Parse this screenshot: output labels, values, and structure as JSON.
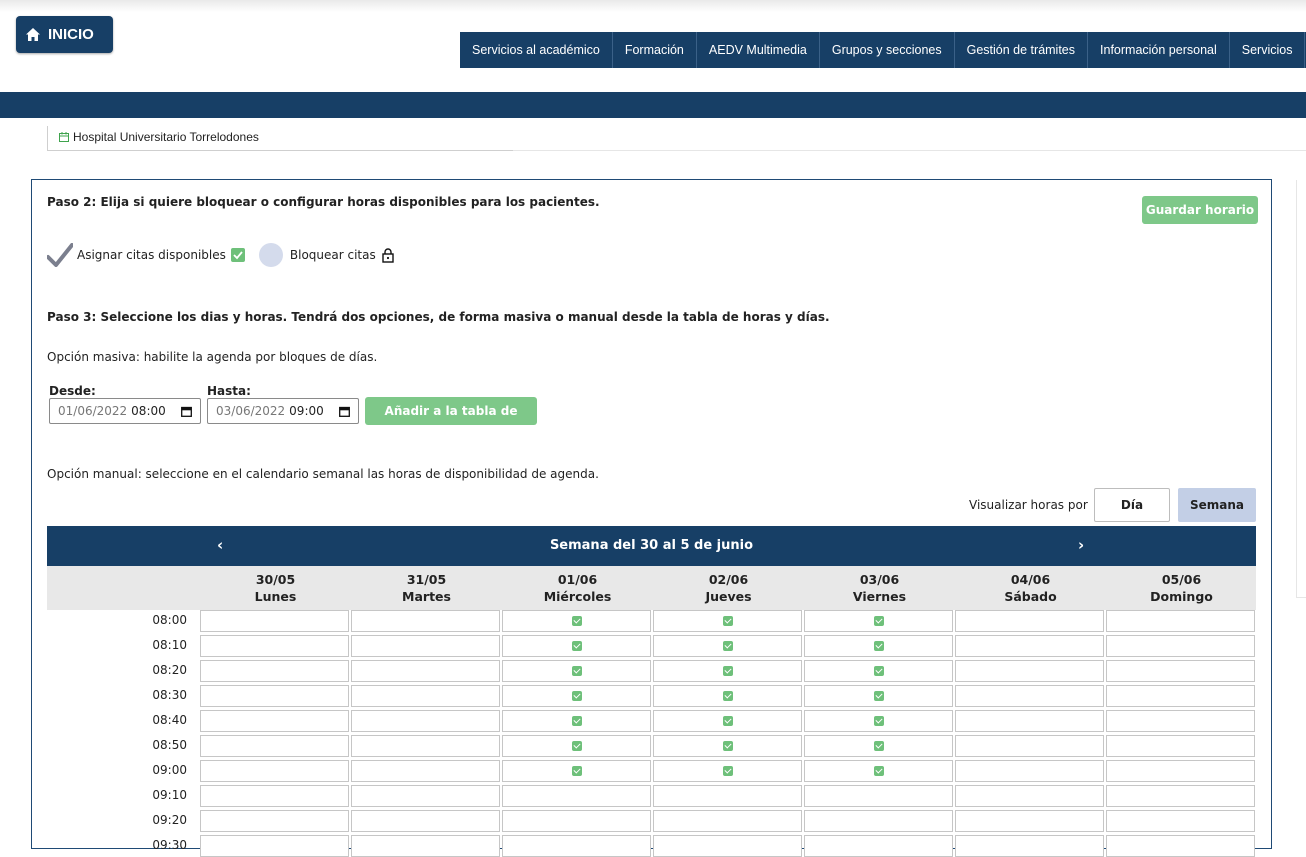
{
  "header": {
    "home_label": "INICIO",
    "nav_items": [
      "Servicios al académico",
      "Formación",
      "AEDV Multimedia",
      "Grupos y secciones",
      "Gestión de trámites",
      "Información personal",
      "Servicios"
    ]
  },
  "location": {
    "hospital": "Hospital Universitario Torrelodones"
  },
  "step2": {
    "title": "Paso 2: Elija si quiere bloquear o configurar horas disponibles para los pacientes.",
    "save_button": "Guardar horario",
    "option_assign": "Asignar citas disponibles",
    "option_block": "Bloquear citas",
    "selected": "Asignar citas disponibles"
  },
  "step3": {
    "title": "Paso 3: Seleccione los dias y horas. Tendrá dos opciones, de forma masiva o manual desde la tabla de horas y días.",
    "bulk_text": "Opción masiva: habilite la agenda por bloques de días.",
    "from_label": "Desde:",
    "from_value": {
      "date": "01/06/2022",
      "time": "08:00"
    },
    "to_label": "Hasta:",
    "to_value": {
      "date": "03/06/2022",
      "time": "09:00"
    },
    "add_button": "Añadir a la tabla de horas",
    "manual_text": "Opción manual: seleccione en el calendario semanal las horas de disponibilidad de agenda.",
    "view_by_label": "Visualizar horas por",
    "view_day": "Día",
    "view_week": "Semana",
    "active_view": "Semana"
  },
  "calendar": {
    "prev": "‹",
    "next": "›",
    "week_title": "Semana del 30 al 5 de junio",
    "days": [
      {
        "date": "30/05",
        "name": "Lunes"
      },
      {
        "date": "31/05",
        "name": "Martes"
      },
      {
        "date": "01/06",
        "name": "Miércoles"
      },
      {
        "date": "02/06",
        "name": "Jueves"
      },
      {
        "date": "03/06",
        "name": "Viernes"
      },
      {
        "date": "04/06",
        "name": "Sábado"
      },
      {
        "date": "05/06",
        "name": "Domingo"
      }
    ],
    "times": [
      "08:00",
      "08:10",
      "08:20",
      "08:30",
      "08:40",
      "08:50",
      "09:00",
      "09:10",
      "09:20",
      "09:30"
    ],
    "checked": [
      [
        false,
        false,
        true,
        true,
        true,
        false,
        false
      ],
      [
        false,
        false,
        true,
        true,
        true,
        false,
        false
      ],
      [
        false,
        false,
        true,
        true,
        true,
        false,
        false
      ],
      [
        false,
        false,
        true,
        true,
        true,
        false,
        false
      ],
      [
        false,
        false,
        true,
        true,
        true,
        false,
        false
      ],
      [
        false,
        false,
        true,
        true,
        true,
        false,
        false
      ],
      [
        false,
        false,
        true,
        true,
        true,
        false,
        false
      ],
      [
        false,
        false,
        false,
        false,
        false,
        false,
        false
      ],
      [
        false,
        false,
        false,
        false,
        false,
        false,
        false
      ],
      [
        false,
        false,
        false,
        false,
        false,
        false,
        false
      ]
    ]
  },
  "colors": {
    "navy": "#173f66",
    "green": "#7ec889",
    "check_green": "#6ec07a",
    "week_button": "#c3cfe6"
  }
}
